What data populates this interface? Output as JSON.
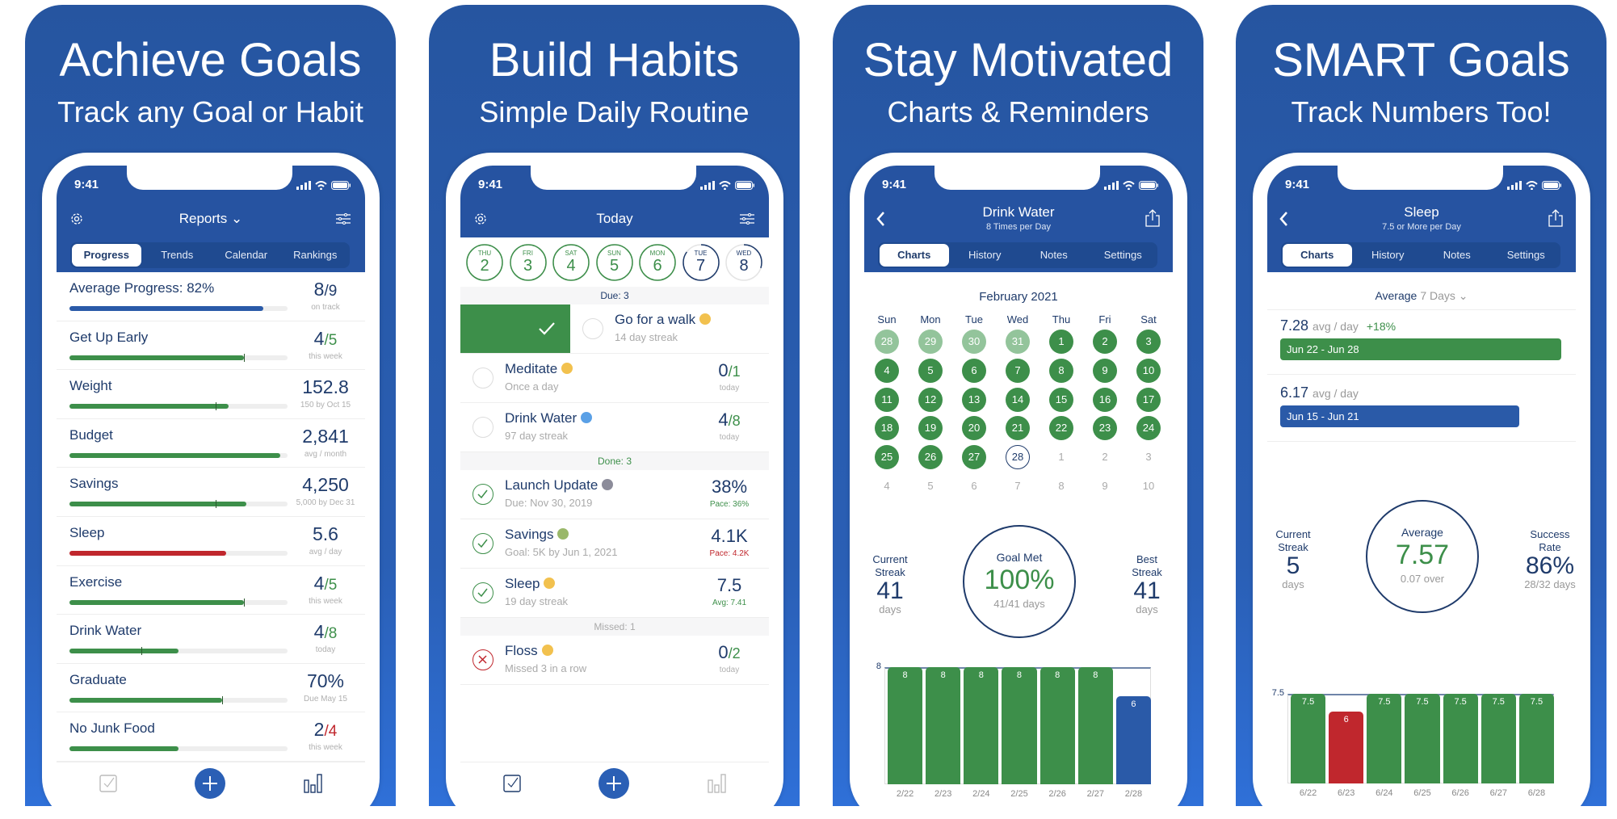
{
  "colors": {
    "header": "#2653a1",
    "green": "#3d8f4a",
    "light_green": "#93c49b",
    "red": "#c0272d",
    "blue_bar": "#2a5aa8",
    "dark_text": "#1f3b6b"
  },
  "status": {
    "time": "9:41"
  },
  "panels": [
    {
      "title": "Achieve Goals",
      "subtitle": "Track any Goal or Habit"
    },
    {
      "title": "Build Habits",
      "subtitle": "Simple Daily Routine"
    },
    {
      "title": "Stay Motivated",
      "subtitle": "Charts & Reminders"
    },
    {
      "title": "SMART Goals",
      "subtitle": "Track Numbers Too!"
    }
  ],
  "reports": {
    "title": "Reports ⌄",
    "icons": {
      "left": "gear-icon",
      "right": "sliders-icon"
    },
    "tabs": [
      "Progress",
      "Trends",
      "Calendar",
      "Rankings"
    ],
    "active_tab": 0,
    "rows": [
      {
        "name": "Average Progress: 82%",
        "value": "8",
        "total": "/9",
        "total_color": "dark",
        "sub": "on track",
        "progress": 0.89,
        "bar": "blue"
      },
      {
        "name": "Get Up Early",
        "value": "4",
        "total": "/5",
        "total_color": "green",
        "sub": "this week",
        "progress": 0.8,
        "marker": 0.8,
        "bar": "green"
      },
      {
        "name": "Weight",
        "value": "152.8",
        "total": "",
        "sub": "150 by Oct 15",
        "progress": 0.73,
        "marker": 0.67,
        "bar": "green"
      },
      {
        "name": "Budget",
        "value": "2,841",
        "total": "",
        "sub": "avg / month",
        "progress": 0.965,
        "bar": "green"
      },
      {
        "name": "Savings",
        "value": "4,250",
        "total": "",
        "sub": "5,000 by Dec 31",
        "progress": 0.81,
        "marker": 0.67,
        "bar": "green"
      },
      {
        "name": "Sleep",
        "value": "5.6",
        "total": "",
        "sub": "avg / day",
        "progress": 0.72,
        "bar": "red"
      },
      {
        "name": "Exercise",
        "value": "4",
        "total": "/5",
        "total_color": "green",
        "sub": "this week",
        "progress": 0.8,
        "marker": 0.8,
        "bar": "green"
      },
      {
        "name": "Drink Water",
        "value": "4",
        "total": "/8",
        "total_color": "green",
        "sub": "today",
        "progress": 0.5,
        "marker": 0.33,
        "bar": "green"
      },
      {
        "name": "Graduate",
        "value": "70%",
        "total": "",
        "sub": "Due May 15",
        "progress": 0.7,
        "marker": 0.7,
        "bar": "green"
      },
      {
        "name": "No Junk Food",
        "value": "2",
        "total": "/4",
        "total_color": "red",
        "sub": "this week",
        "progress": 0.5,
        "bar": "green"
      }
    ],
    "tabbar": [
      "checkbox-icon",
      "add-icon",
      "bar-chart-icon"
    ],
    "tabbar_active": 2
  },
  "today": {
    "title": "Today",
    "days": [
      {
        "dow": "THU",
        "day": "2",
        "progress": 1
      },
      {
        "dow": "FRI",
        "day": "3",
        "progress": 1
      },
      {
        "dow": "SAT",
        "day": "4",
        "progress": 1
      },
      {
        "dow": "SUN",
        "day": "5",
        "progress": 1
      },
      {
        "dow": "MON",
        "day": "6",
        "progress": 1
      },
      {
        "dow": "TUE",
        "day": "7",
        "progress": 0.85
      },
      {
        "dow": "WED",
        "day": "8",
        "progress": 0.3
      }
    ],
    "items": [
      {
        "section": "Due: 3",
        "tone": "dark"
      },
      {
        "name": "Go for a walk",
        "emoji": "person-walking-emoji",
        "sub": "14 day streak",
        "state": "swiped"
      },
      {
        "name": "Meditate",
        "emoji": "person-meditating-emoji",
        "sub": "Once a day",
        "value": "0",
        "total": "/1",
        "total_color": "green",
        "vsub": "today",
        "state": "open"
      },
      {
        "name": "Drink Water",
        "emoji": "droplet-emoji",
        "sub": "97 day streak",
        "value": "4",
        "total": "/8",
        "total_color": "green",
        "vsub": "today",
        "state": "open"
      },
      {
        "section": "Done: 3",
        "tone": "green"
      },
      {
        "name": "Launch Update",
        "emoji": "technologist-emoji",
        "sub": "Due: Nov 30, 2019",
        "value": "38%",
        "total": "",
        "vsub": "Pace: 36%",
        "vsub_color": "green",
        "state": "done"
      },
      {
        "name": "Savings",
        "emoji": "money-emoji",
        "sub": "Goal: 5K by Jun 1, 2021",
        "value": "4.1K",
        "total": "",
        "vsub": "Pace: 4.2K",
        "vsub_color": "red",
        "state": "done"
      },
      {
        "name": "Sleep",
        "emoji": "sleeping-face-emoji",
        "sub": "19 day streak",
        "value": "7.5",
        "total": "",
        "vsub": "Avg: 7.41",
        "vsub_color": "green",
        "state": "done"
      },
      {
        "section": "Missed: 1",
        "tone": "grey"
      },
      {
        "name": "Floss",
        "emoji": "grimacing-face-emoji",
        "sub": "Missed 3 in a row",
        "value": "0",
        "total": "/2",
        "total_color": "green",
        "vsub": "today",
        "state": "missed"
      }
    ],
    "tabbar_active": 0
  },
  "water": {
    "title": "Drink Water",
    "subtitle": "8 Times per Day",
    "tabs": [
      "Charts",
      "History",
      "Notes",
      "Settings"
    ],
    "active_tab": 0,
    "month": "February 2021",
    "weekdays": [
      "Sun",
      "Mon",
      "Tue",
      "Wed",
      "Thu",
      "Fri",
      "Sat"
    ],
    "cells": [
      [
        "28",
        "prev"
      ],
      [
        "29",
        "prev"
      ],
      [
        "30",
        "prev"
      ],
      [
        "31",
        "prev"
      ],
      [
        "1",
        "done"
      ],
      [
        "2",
        "done"
      ],
      [
        "3",
        "done"
      ],
      [
        "4",
        "done"
      ],
      [
        "5",
        "done"
      ],
      [
        "6",
        "done"
      ],
      [
        "7",
        "done"
      ],
      [
        "8",
        "done"
      ],
      [
        "9",
        "done"
      ],
      [
        "10",
        "done"
      ],
      [
        "11",
        "done"
      ],
      [
        "12",
        "done"
      ],
      [
        "13",
        "done"
      ],
      [
        "14",
        "done"
      ],
      [
        "15",
        "done"
      ],
      [
        "16",
        "done"
      ],
      [
        "17",
        "done"
      ],
      [
        "18",
        "done"
      ],
      [
        "19",
        "done"
      ],
      [
        "20",
        "done"
      ],
      [
        "21",
        "done"
      ],
      [
        "22",
        "done"
      ],
      [
        "23",
        "done"
      ],
      [
        "24",
        "done"
      ],
      [
        "25",
        "done"
      ],
      [
        "26",
        "done"
      ],
      [
        "27",
        "done"
      ],
      [
        "28",
        "today"
      ],
      [
        "1",
        "future"
      ],
      [
        "2",
        "future"
      ],
      [
        "3",
        "future"
      ],
      [
        "4",
        "future"
      ],
      [
        "5",
        "future"
      ],
      [
        "6",
        "future"
      ],
      [
        "7",
        "future"
      ],
      [
        "8",
        "future"
      ],
      [
        "9",
        "future"
      ],
      [
        "10",
        "future"
      ]
    ],
    "stats": {
      "left": {
        "label1": "Current",
        "label2": "Streak",
        "value": "41",
        "unit": "days"
      },
      "center": {
        "label": "Goal Met",
        "value": "100%",
        "sub": "41/41 days"
      },
      "right": {
        "label1": "Best",
        "label2": "Streak",
        "value": "41",
        "unit": "days"
      }
    }
  },
  "sleep": {
    "title": "Sleep",
    "subtitle": "7.5 or More per Day",
    "tabs": [
      "Charts",
      "History",
      "Notes",
      "Settings"
    ],
    "active_tab": 0,
    "period_label": "Average",
    "period_value": "7 Days ⌄",
    "averages": [
      {
        "value": "7.28",
        "unit": "avg / day",
        "change": "+18%",
        "range": "Jun 22 - Jun 28",
        "fraction": 1.0,
        "color": "green"
      },
      {
        "value": "6.17",
        "unit": "avg / day",
        "change": "",
        "range": "Jun 15 - Jun 21",
        "fraction": 0.85,
        "color": "blue"
      }
    ],
    "stats": {
      "left": {
        "label1": "Current",
        "label2": "Streak",
        "value": "5",
        "unit": "days"
      },
      "center": {
        "label": "Average",
        "value": "7.57",
        "sub": "0.07 over"
      },
      "right": {
        "label1": "Success",
        "label2": "Rate",
        "value": "86%",
        "unit": "28/32 days"
      }
    }
  },
  "chart_data": [
    {
      "type": "bar",
      "categories": [
        "2/22",
        "2/23",
        "2/24",
        "2/25",
        "2/26",
        "2/27",
        "2/28"
      ],
      "values": [
        8,
        8,
        8,
        8,
        8,
        8,
        6
      ],
      "bar_colors": [
        "green",
        "green",
        "green",
        "green",
        "green",
        "green",
        "blue"
      ],
      "goal": 8,
      "ytick": "8",
      "ylim": [
        0,
        8
      ]
    },
    {
      "type": "bar",
      "categories": [
        "6/22",
        "6/23",
        "6/24",
        "6/25",
        "6/26",
        "6/27",
        "6/28"
      ],
      "values": [
        7.5,
        6,
        7.5,
        7.5,
        7.5,
        7.5,
        7.5
      ],
      "bar_colors": [
        "green",
        "red",
        "green",
        "green",
        "green",
        "green",
        "green"
      ],
      "goal": 7.5,
      "ytick": "7.5",
      "ylim": [
        0,
        7.5
      ]
    }
  ]
}
